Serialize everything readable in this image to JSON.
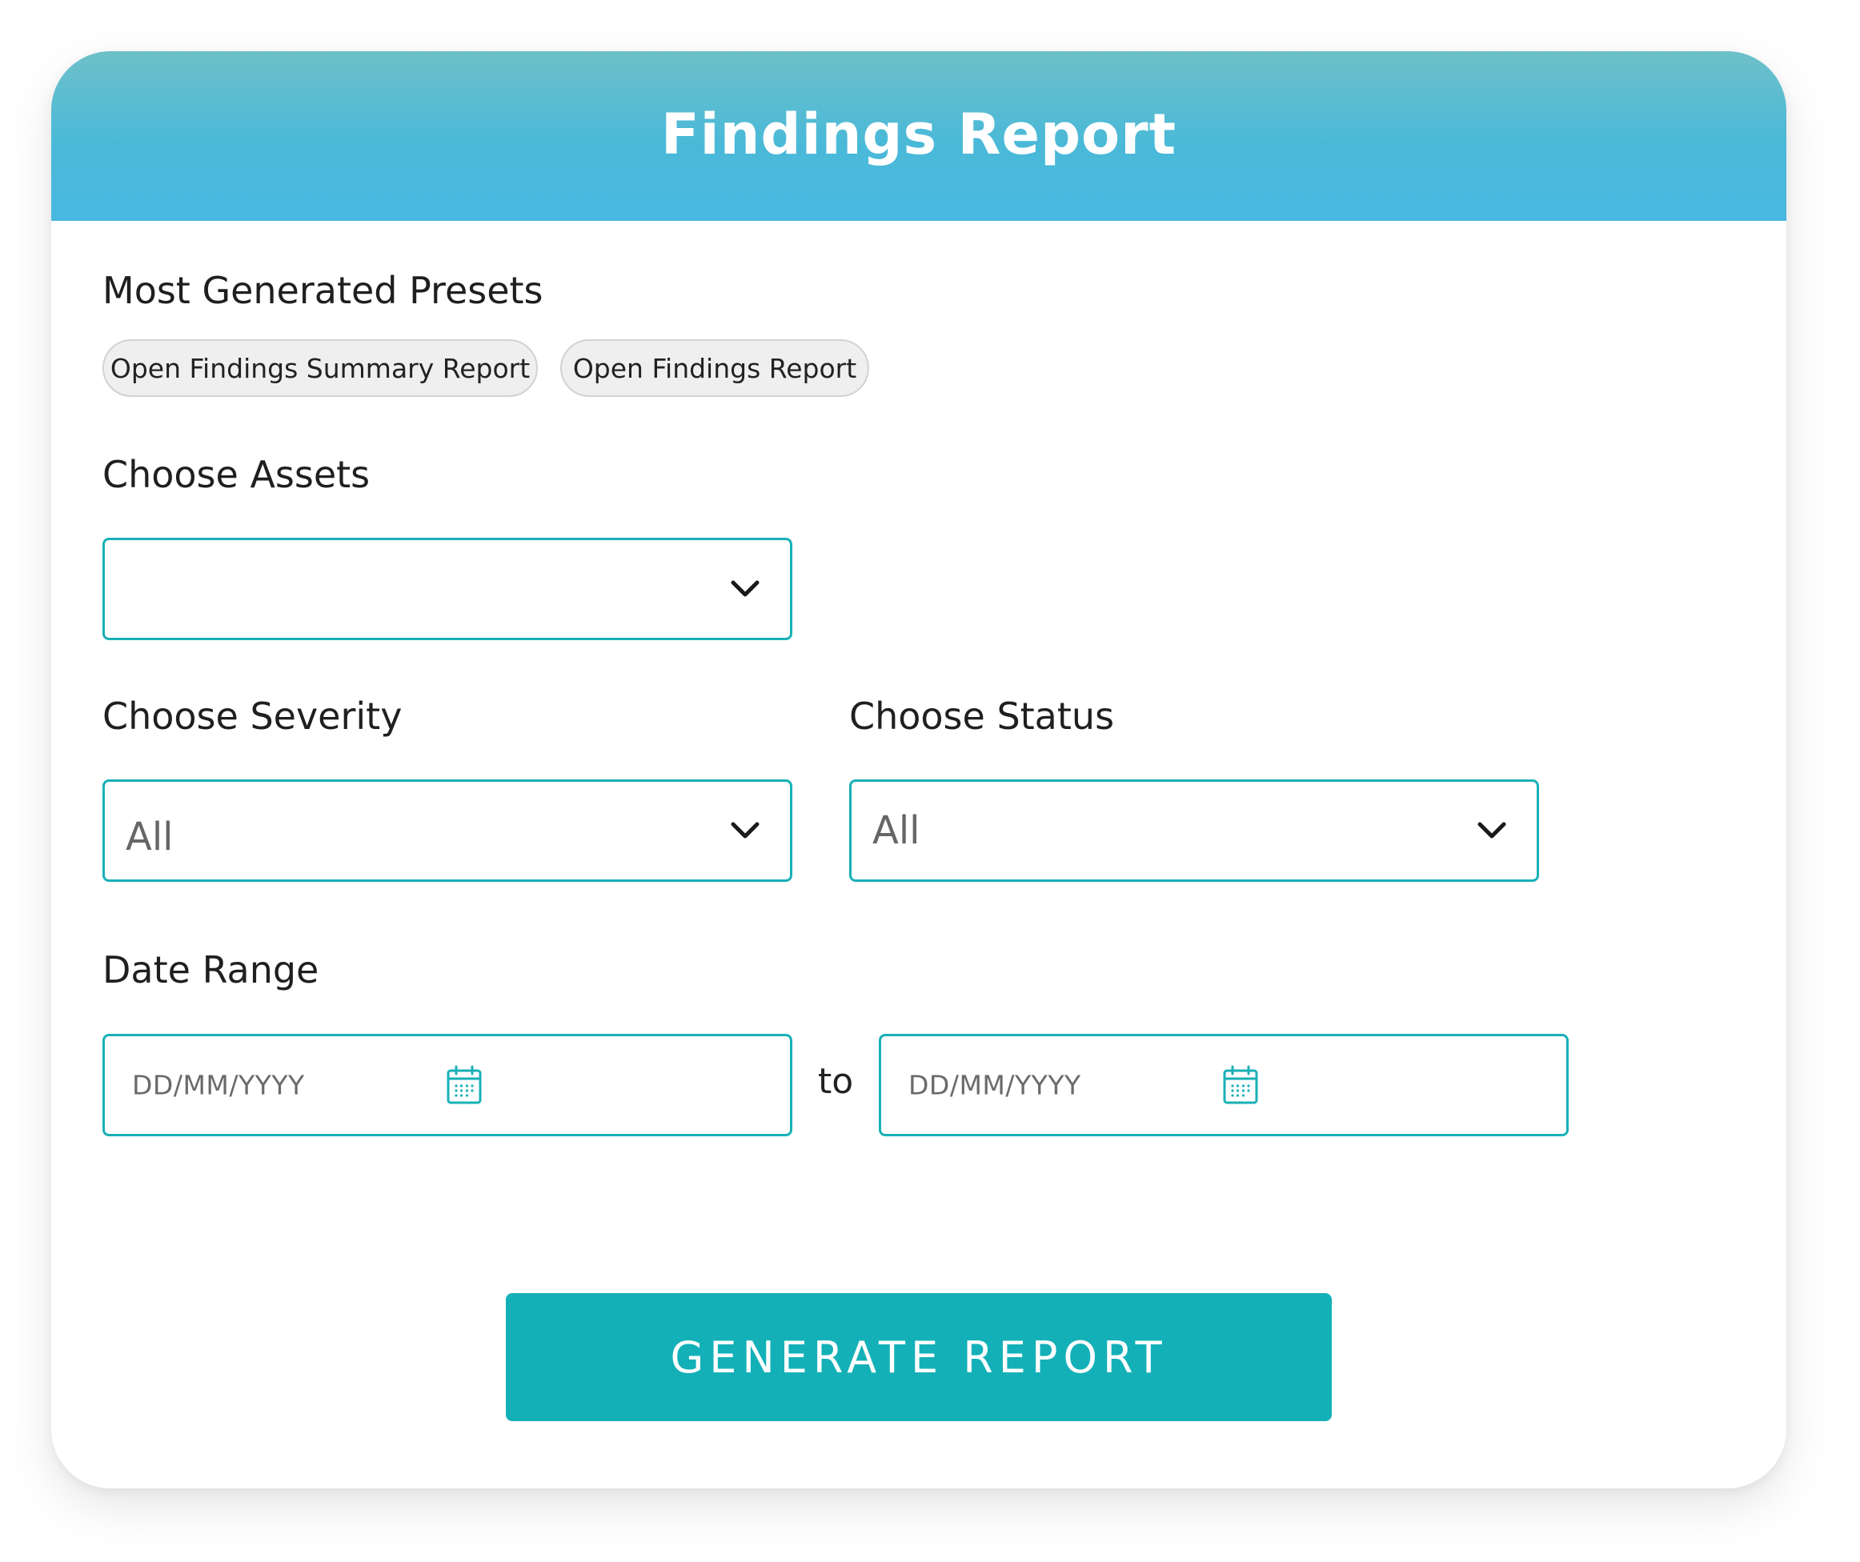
{
  "header": {
    "title": "Findings Report"
  },
  "presets": {
    "label": "Most Generated Presets",
    "items": [
      "Open Findings Summary Report",
      "Open Findings Report"
    ]
  },
  "assets": {
    "label": "Choose Assets",
    "value": ""
  },
  "severity": {
    "label": "Choose Severity",
    "value": "All"
  },
  "status": {
    "label": "Choose Status",
    "value": "All"
  },
  "date_range": {
    "label": "Date Range",
    "from_placeholder": "DD/MM/YYYY",
    "separator": "to",
    "to_placeholder": "DD/MM/YYYY"
  },
  "actions": {
    "generate_label": "GENERATE REPORT"
  },
  "colors": {
    "accent": "#19b0b7",
    "button": "#14b0b8",
    "header_top": "#6ec0c9",
    "header_bottom": "#48b8e0"
  },
  "icons": {
    "dropdown": "chevron-down-icon",
    "date": "calendar-icon"
  }
}
